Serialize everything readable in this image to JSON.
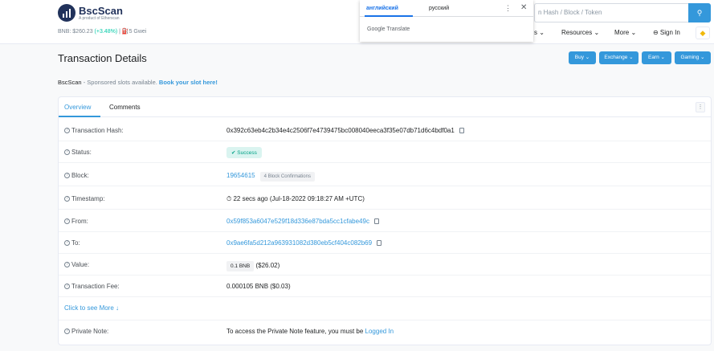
{
  "header": {
    "logo_name": "BscScan",
    "logo_sub": "A product of Etherscan",
    "price_label": "BNB: $260.23",
    "price_change": "(+3.48%)",
    "gas": "| ⛽5 Gwei",
    "search_placeholder": "n Hash / Block / Token",
    "nav": {
      "partial": "s ⌄",
      "resources": "Resources ⌄",
      "more": "More ⌄",
      "signin": "⊖ Sign In"
    }
  },
  "translate": {
    "tab_en": "английский",
    "tab_ru": "русский",
    "more": "⋮",
    "close": "✕",
    "brand": "Google Translate"
  },
  "page": {
    "title": "Transaction Details",
    "buttons": [
      "Buy ⌄",
      "Exchange ⌄",
      "Earn ⌄",
      "Gaming ⌄"
    ],
    "sponsor_brand": "BscScan",
    "sponsor_text": " - Sponsored slots available. ",
    "sponsor_link": "Book your slot here!"
  },
  "tabs": {
    "overview": "Overview",
    "comments": "Comments"
  },
  "rows": {
    "hash_label": "Transaction Hash:",
    "hash": "0x392c63eb4c2b34e4c2506f7e4739475bc008040eeca3f35e07db71d6c4bdf0a1",
    "status_label": "Status:",
    "status": "Success",
    "block_label": "Block:",
    "block": "19654615",
    "confirmations": "4 Block Confirmations",
    "timestamp_label": "Timestamp:",
    "timestamp": "⏱ 22 secs ago (Jul-18-2022 09:18:27 AM +UTC)",
    "from_label": "From:",
    "from": "0x59f853a6047e529f18d336e87bda5cc1cfabe49c",
    "to_label": "To:",
    "to": "0x9ae6fa5d212a963931082d380eb5cf404c082b69",
    "value_label": "Value:",
    "value": "0.1 BNB",
    "value_usd": "($26.02)",
    "fee_label": "Transaction Fee:",
    "fee": "0.000105 BNB ($0.03)",
    "more_link": "Click to see More ↓",
    "note_label": "Private Note:",
    "note_text": "To access the Private Note feature, you must be ",
    "note_link": "Logged In"
  }
}
